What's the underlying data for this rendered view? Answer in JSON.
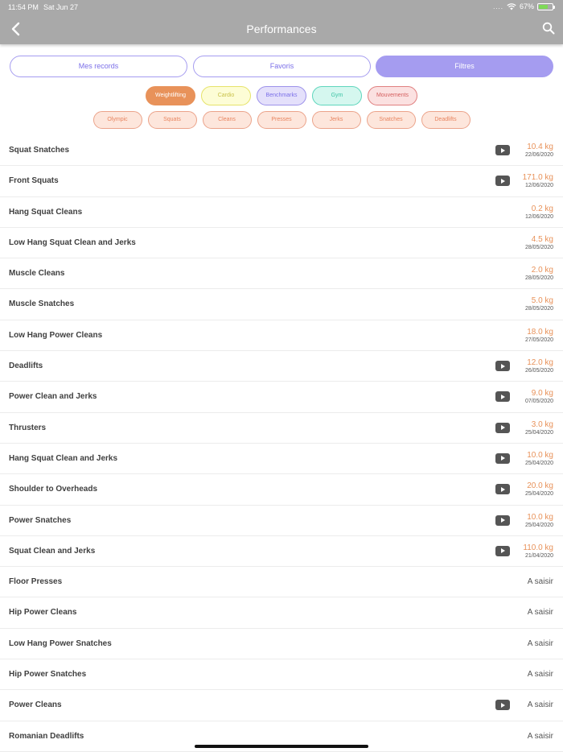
{
  "status": {
    "time": "11:54 PM",
    "date": "Sat Jun 27",
    "dots": "....",
    "battery": "67%"
  },
  "header": {
    "title": "Performances",
    "back_icon": "chevron-left-icon",
    "search_icon": "search-icon"
  },
  "tabs": [
    {
      "label": "Mes records",
      "active": false
    },
    {
      "label": "Favoris",
      "active": false
    },
    {
      "label": "Filtres",
      "active": true
    }
  ],
  "category_chips": [
    {
      "label": "Weightlifting",
      "bg": "#e8925a",
      "border": "#e8925a",
      "text": "#ffffff"
    },
    {
      "label": "Cardio",
      "bg": "#fdfdd6",
      "border": "#e6e36a",
      "text": "#c9c24a"
    },
    {
      "label": "Benchmarks",
      "bg": "#e4e0fb",
      "border": "#9d92ea",
      "text": "#7b6fe8"
    },
    {
      "label": "Gym",
      "bg": "#d5f7ef",
      "border": "#5fd6bd",
      "text": "#3fc4a6"
    },
    {
      "label": "Mouvements",
      "bg": "#fbe1e1",
      "border": "#e08080",
      "text": "#d45f5f"
    }
  ],
  "movement_chips": [
    {
      "label": "Olympic"
    },
    {
      "label": "Squats"
    },
    {
      "label": "Cleans"
    },
    {
      "label": "Presses"
    },
    {
      "label": "Jerks"
    },
    {
      "label": "Snatches"
    },
    {
      "label": "Deadlifts"
    }
  ],
  "movement_chip_style": {
    "bg": "#fde6dc",
    "border": "#eba38a",
    "text": "#e8845f"
  },
  "performances": [
    {
      "name": "Squat Snatches",
      "video": true,
      "value": "10.4 kg",
      "date": "22/06/2020"
    },
    {
      "name": "Front Squats",
      "video": true,
      "value": "171.0 kg",
      "date": "12/06/2020"
    },
    {
      "name": "Hang Squat Cleans",
      "video": false,
      "value": "0.2 kg",
      "date": "12/06/2020"
    },
    {
      "name": "Low Hang Squat Clean and Jerks",
      "video": false,
      "value": "4.5 kg",
      "date": "28/05/2020"
    },
    {
      "name": "Muscle Cleans",
      "video": false,
      "value": "2.0 kg",
      "date": "28/05/2020"
    },
    {
      "name": "Muscle Snatches",
      "video": false,
      "value": "5.0 kg",
      "date": "28/05/2020"
    },
    {
      "name": "Low Hang Power Cleans",
      "video": false,
      "value": "18.0 kg",
      "date": "27/05/2020"
    },
    {
      "name": "Deadlifts",
      "video": true,
      "value": "12.0 kg",
      "date": "26/05/2020"
    },
    {
      "name": "Power Clean and Jerks",
      "video": true,
      "value": "9.0 kg",
      "date": "07/05/2020"
    },
    {
      "name": "Thrusters",
      "video": true,
      "value": "3.0 kg",
      "date": "25/04/2020"
    },
    {
      "name": "Hang Squat Clean and Jerks",
      "video": true,
      "value": "10.0 kg",
      "date": "25/04/2020"
    },
    {
      "name": "Shoulder to Overheads",
      "video": true,
      "value": "20.0 kg",
      "date": "25/04/2020"
    },
    {
      "name": "Power Snatches",
      "video": true,
      "value": "10.0 kg",
      "date": "25/04/2020"
    },
    {
      "name": "Squat Clean and Jerks",
      "video": true,
      "value": "110.0 kg",
      "date": "21/04/2020"
    },
    {
      "name": "Floor Presses",
      "video": false,
      "empty": "A saisir"
    },
    {
      "name": "Hip Power Cleans",
      "video": false,
      "empty": "A saisir"
    },
    {
      "name": "Low Hang Power Snatches",
      "video": false,
      "empty": "A saisir"
    },
    {
      "name": "Hip Power Snatches",
      "video": false,
      "empty": "A saisir"
    },
    {
      "name": "Power Cleans",
      "video": true,
      "empty": "A saisir"
    },
    {
      "name": "Romanian Deadlifts",
      "video": false,
      "empty": "A saisir"
    }
  ]
}
